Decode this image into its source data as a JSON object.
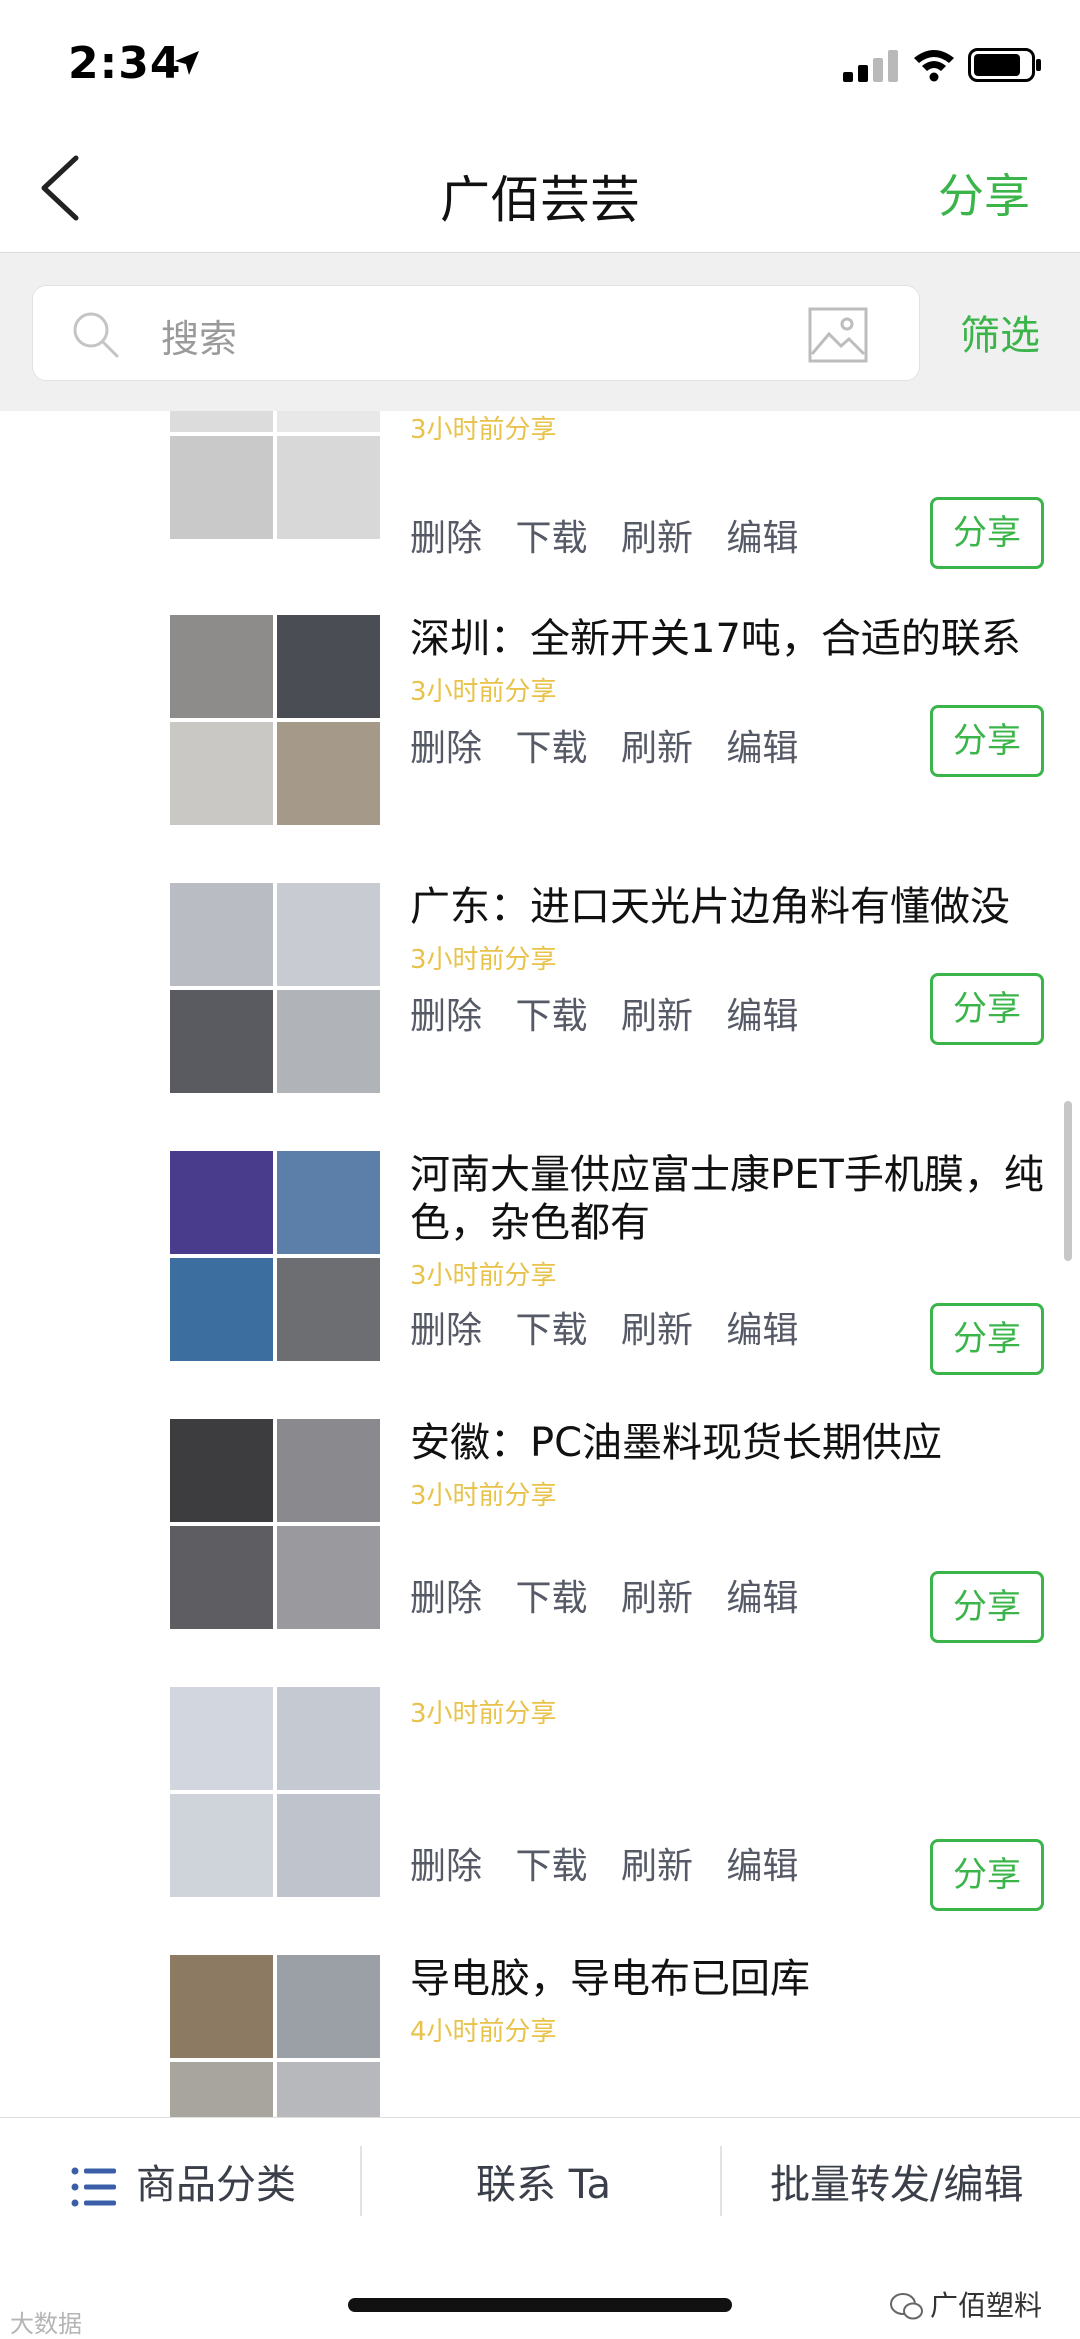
{
  "status_bar": {
    "time": "2:34"
  },
  "nav": {
    "title": "广佰芸芸",
    "share_label": "分享"
  },
  "search": {
    "placeholder": "搜索",
    "filter_label": "筛选"
  },
  "actions": {
    "delete": "删除",
    "download": "下载",
    "refresh": "刷新",
    "edit": "编辑",
    "share": "分享"
  },
  "items": [
    {
      "title": "",
      "time": "3小时前分享",
      "thumb_colors": [
        "#dcdcdc",
        "#e8e8e8",
        "#c9c9c9",
        "#d8d8d8"
      ]
    },
    {
      "title": "深圳：全新开关17吨，合适的联系",
      "time": "3小时前分享",
      "thumb_colors": [
        "#8e8c8a",
        "#4b4d55",
        "#c9c8c5",
        "#a59a8a"
      ]
    },
    {
      "title": "广东：进口天光片边角料有懂做没",
      "time": "3小时前分享",
      "thumb_colors": [
        "#b9bcc2",
        "#c8cbd1",
        "#5a5b60",
        "#b0b3b8"
      ]
    },
    {
      "title": "河南大量供应富士康PET手机膜，纯色，杂色都有",
      "time": "3小时前分享",
      "thumb_colors": [
        "#4a3c8c",
        "#5b7fa8",
        "#3d6ea0",
        "#6d6e72"
      ]
    },
    {
      "title": "安徽：PC油墨料现货长期供应",
      "time": "3小时前分享",
      "thumb_colors": [
        "#3d3d40",
        "#8a8a8e",
        "#5e5e62",
        "#9a9a9e"
      ]
    },
    {
      "title": "",
      "time": "3小时前分享",
      "thumb_colors": [
        "#d2d6de",
        "#c5cad2",
        "#cfd3da",
        "#bfc4cc"
      ]
    },
    {
      "title": "导电胶，导电布已回库",
      "time": "4小时前分享",
      "thumb_colors": [
        "#8c7a62",
        "#9aa0a6",
        "#a8a49e",
        "#b6b8bb"
      ]
    }
  ],
  "bottom_bar": {
    "category_label": "商品分类",
    "contact_label": "联系 Ta",
    "batch_label": "批量转发/编辑"
  },
  "watermarks": {
    "left": "大数据",
    "right": "广佰塑料"
  }
}
